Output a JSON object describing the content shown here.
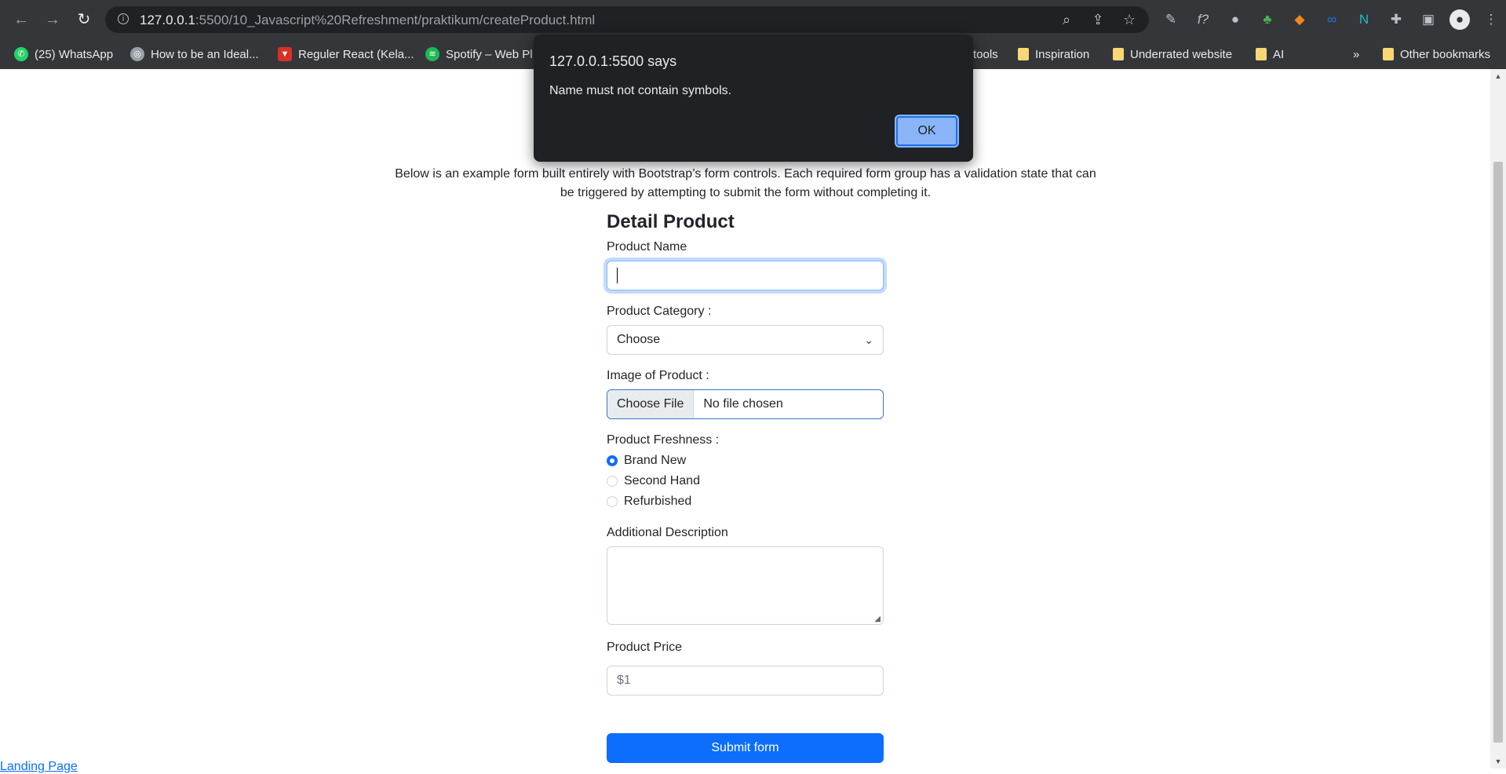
{
  "browser": {
    "url_host": "127.0.0.1",
    "url_rest": ":5500/10_Javascript%20Refreshment/praktikum/createProduct.html",
    "bookmarks": [
      {
        "label": "(25) WhatsApp",
        "icon": "whatsapp-icon"
      },
      {
        "label": "How to be an Ideal...",
        "icon": "globe-icon"
      },
      {
        "label": "Reguler React (Kela...",
        "icon": "tie-icon"
      },
      {
        "label": "Spotify – Web Pl",
        "icon": "spotify-icon"
      },
      {
        "label": "tools",
        "icon": "folder-icon"
      },
      {
        "label": "Inspiration",
        "icon": "folder-icon"
      },
      {
        "label": "Underrated website",
        "icon": "folder-icon"
      },
      {
        "label": "AI",
        "icon": "folder-icon"
      },
      {
        "label": "»",
        "icon": "more-bookmarks-icon"
      },
      {
        "label": "Other bookmarks",
        "icon": "folder-icon"
      }
    ]
  },
  "dialog": {
    "origin": "127.0.0.1:5500 says",
    "message": "Name must not contain symbols.",
    "ok_label": "OK"
  },
  "page": {
    "lead": "Below is an example form built entirely with Bootstrap’s form controls. Each required form group has a validation state that can be triggered by attempting to submit the form without completing it.",
    "form_title": "Detail Product",
    "product_name_label": "Product Name",
    "product_name_value": "",
    "category_label": "Product Category :",
    "category_selected": "Choose",
    "image_label": "Image of Product :",
    "choose_file_label": "Choose File",
    "no_file_label": "No file chosen",
    "freshness_label": "Product Freshness :",
    "freshness_options": [
      "Brand New",
      "Second Hand",
      "Refurbished"
    ],
    "freshness_selected": "Brand New",
    "description_label": "Additional Description",
    "price_label": "Product Price",
    "price_placeholder": "$1",
    "submit_label": "Submit form",
    "landing_link": "Landing Page"
  },
  "colors": {
    "primary": "#0d6efd",
    "chrome": "#35363a",
    "dialog": "#202124"
  }
}
